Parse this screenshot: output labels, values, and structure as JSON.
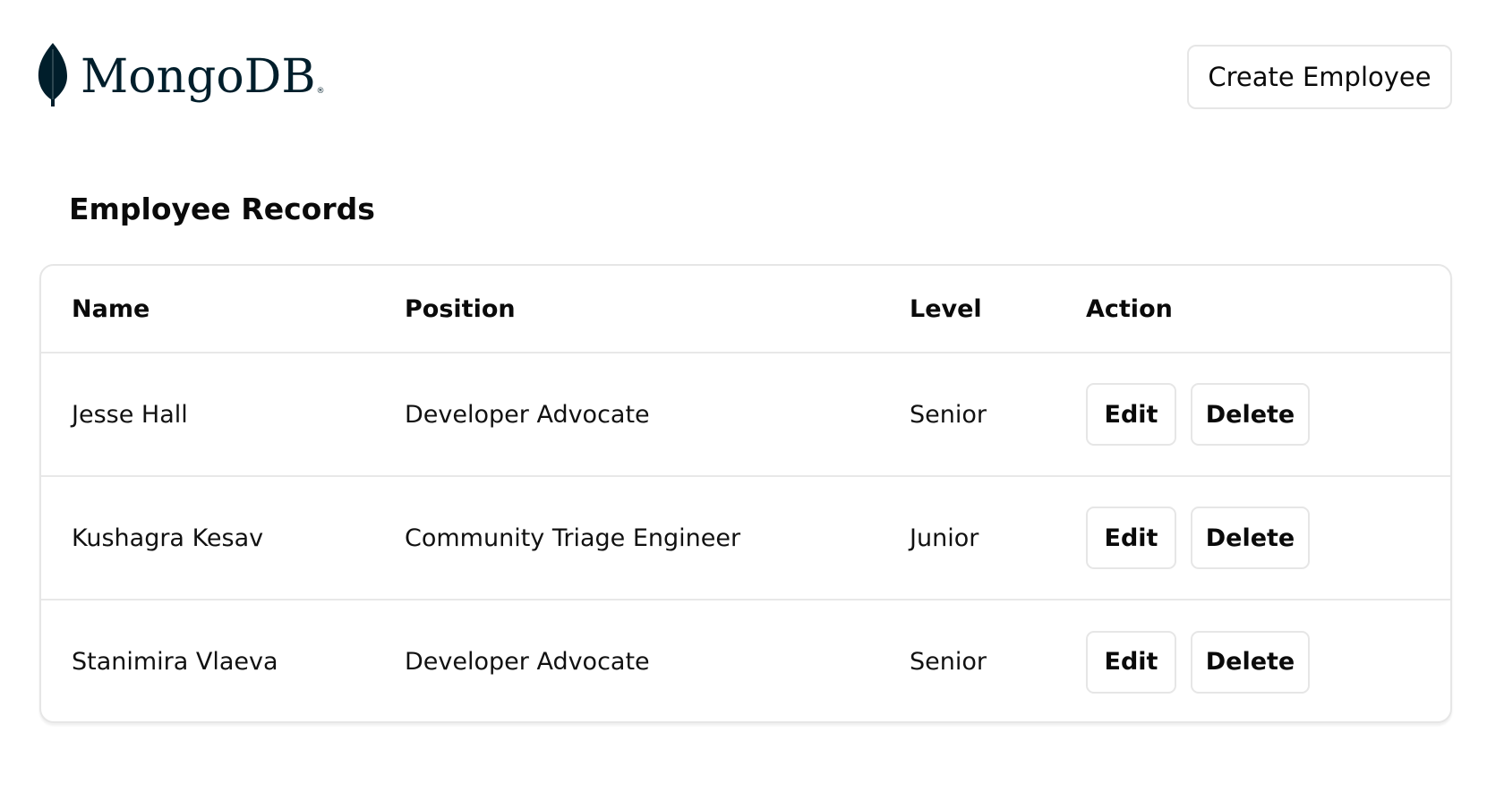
{
  "header": {
    "logo": {
      "icon": "leaf-icon",
      "text": "MongoDB",
      "registered_mark": "®",
      "color": "#001e2b"
    },
    "create_button_label": "Create Employee"
  },
  "page": {
    "title": "Employee Records"
  },
  "table": {
    "columns": [
      "Name",
      "Position",
      "Level",
      "Action"
    ],
    "rows": [
      {
        "name": "Jesse Hall",
        "position": "Developer Advocate",
        "level": "Senior",
        "edit_label": "Edit",
        "delete_label": "Delete"
      },
      {
        "name": "Kushagra Kesav",
        "position": "Community Triage Engineer",
        "level": "Junior",
        "edit_label": "Edit",
        "delete_label": "Delete"
      },
      {
        "name": "Stanimira Vlaeva",
        "position": "Developer Advocate",
        "level": "Senior",
        "edit_label": "Edit",
        "delete_label": "Delete"
      }
    ]
  },
  "colors": {
    "border": "#e6e6e6",
    "text": "#0a0a0a",
    "background": "#ffffff"
  }
}
